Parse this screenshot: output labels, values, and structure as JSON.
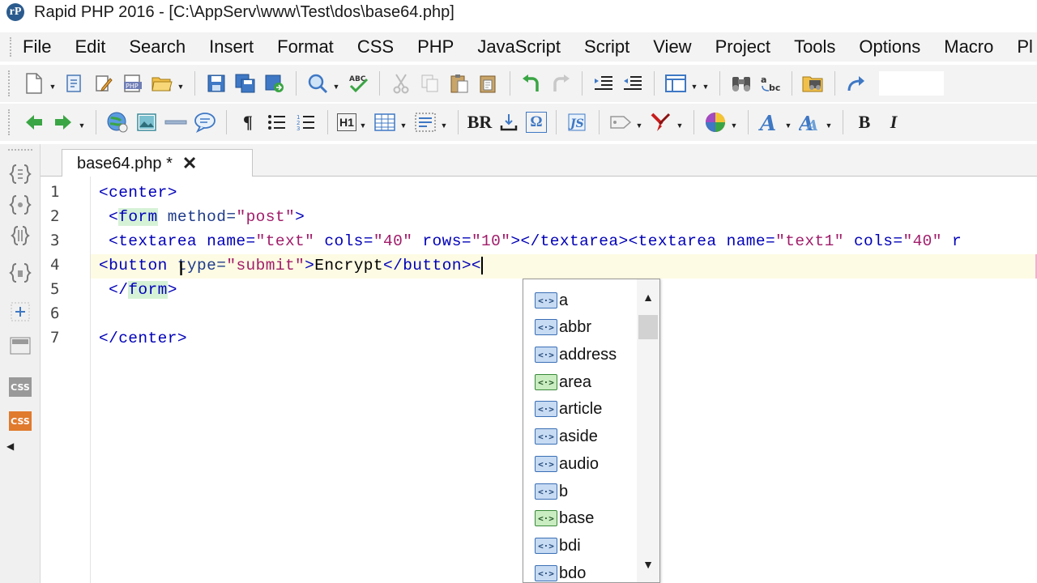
{
  "window": {
    "title": "Rapid PHP 2016 - [C:\\AppServ\\www\\Test\\dos\\base64.php]",
    "logo": "rP"
  },
  "menu": [
    "File",
    "Edit",
    "Search",
    "Insert",
    "Format",
    "CSS",
    "PHP",
    "JavaScript",
    "Script",
    "View",
    "Project",
    "Tools",
    "Options",
    "Macro",
    "Pl"
  ],
  "toolbar2": {
    "h1": "H1",
    "br": "BR",
    "omega": "Ω",
    "pilcrow": "¶",
    "bold": "B",
    "italic": "I"
  },
  "tab": {
    "label": "base64.php *",
    "close": "✕"
  },
  "editor": {
    "line_numbers": [
      "1",
      "2",
      "3",
      "4",
      "5",
      "6",
      "7"
    ],
    "lines": [
      {
        "l1": "<center>"
      },
      {
        "open": " <",
        "tag": "form",
        "attr": " method=",
        "val": "\"post\"",
        "close": ">"
      },
      {
        "a": " <textarea name=",
        "v1": "\"text\"",
        "b": " cols=",
        "v2": "\"40\"",
        "c": " rows=",
        "v3": "\"10\"",
        "d": "></textarea><textarea name=",
        "v4": "\"text1\"",
        "e": " cols=",
        "v5": "\"40\"",
        "f": " r"
      },
      {
        "a": "<button ",
        "b": "type=",
        "v1": "\"submit\"",
        "c": ">",
        "text": "Encrypt",
        "d": "</button><"
      },
      {
        "open": " </",
        "tag": "form",
        "close": ">"
      },
      {
        "text": ""
      },
      {
        "l7": "</center>"
      }
    ]
  },
  "autocomplete": {
    "icon_text": "<·>",
    "items": [
      {
        "label": "a",
        "color": "blue"
      },
      {
        "label": "abbr",
        "color": "blue"
      },
      {
        "label": "address",
        "color": "blue"
      },
      {
        "label": "area",
        "color": "green"
      },
      {
        "label": "article",
        "color": "blue"
      },
      {
        "label": "aside",
        "color": "blue"
      },
      {
        "label": "audio",
        "color": "blue"
      },
      {
        "label": "b",
        "color": "blue"
      },
      {
        "label": "base",
        "color": "green"
      },
      {
        "label": "bdi",
        "color": "blue"
      },
      {
        "label": "bdo",
        "color": "blue"
      }
    ]
  },
  "leftpanel": {
    "css1": "CSS",
    "css2": "CSS"
  },
  "colors": {
    "tag": "#0000b8",
    "attribute": "#1e3b8a",
    "value": "#a11d6a",
    "current_line": "#fdfbe3"
  }
}
